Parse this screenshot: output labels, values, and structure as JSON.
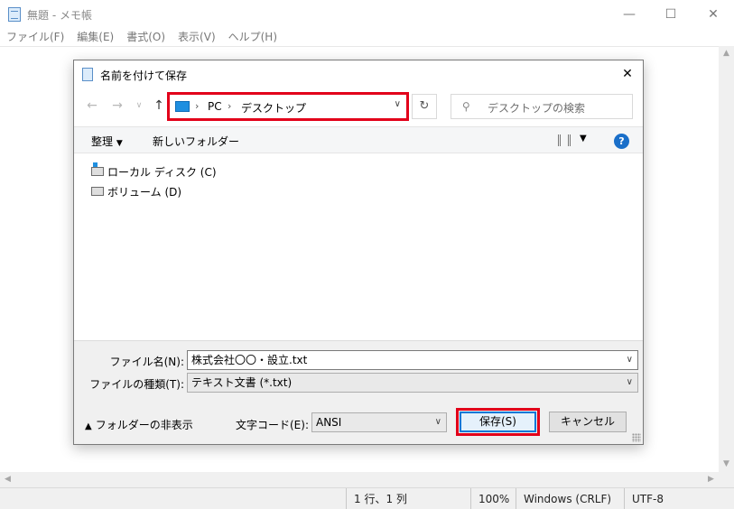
{
  "notepad": {
    "title": "無題 - メモ帳",
    "menu": [
      "ファイル(F)",
      "編集(E)",
      "書式(O)",
      "表示(V)",
      "ヘルプ(H)"
    ],
    "status": {
      "position": "1 行、1 列",
      "zoom": "100%",
      "line_ending": "Windows (CRLF)",
      "encoding": "UTF-8"
    }
  },
  "dialog": {
    "title": "名前を付けて保存",
    "address": {
      "root": "PC",
      "folder": "デスクトップ"
    },
    "search_placeholder": "デスクトップの検索",
    "toolbar": {
      "organize": "整理",
      "new_folder": "新しいフォルダー"
    },
    "drives": [
      "ローカル ディスク (C)",
      "ボリューム (D)"
    ],
    "filename_label": "ファイル名(N):",
    "filename_value": "株式会社〇〇・設立.txt",
    "filetype_label": "ファイルの種類(T):",
    "filetype_value": "テキスト文書 (*.txt)",
    "hide_folders": "フォルダーの非表示",
    "encoding_label": "文字コード(E):",
    "encoding_value": "ANSI",
    "save_button": "保存(S)",
    "cancel_button": "キャンセル"
  },
  "colors": {
    "highlight": "#e2001a",
    "accent": "#0078d7"
  }
}
